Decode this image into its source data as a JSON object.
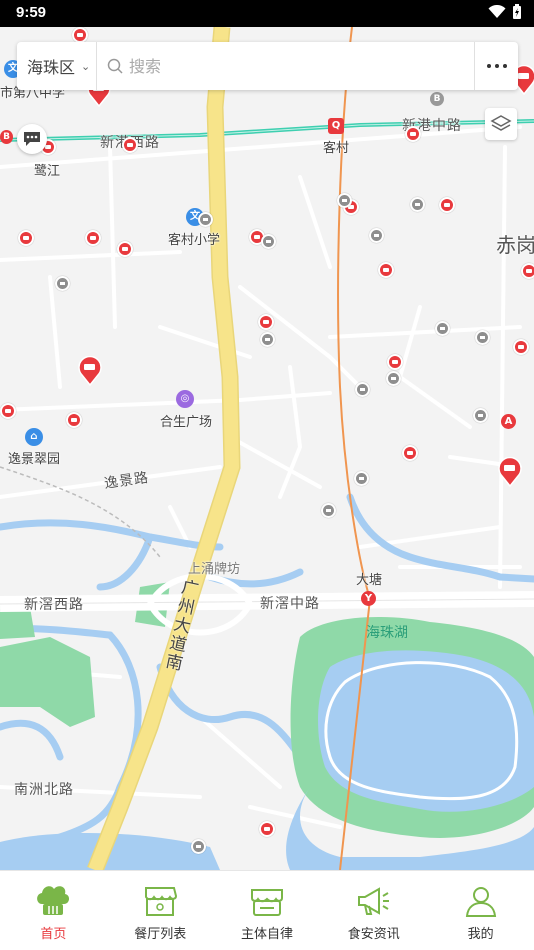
{
  "status_bar": {
    "time": "9:59"
  },
  "search": {
    "district": "海珠区",
    "placeholder": "搜索"
  },
  "map": {
    "labels": {
      "xinjiang_west": "新滘西路",
      "xinjiang_middle": "新滘中路",
      "xingang_west": "新港西路",
      "xingang_middle": "新港中路",
      "yijing_road": "逸景路",
      "nanzhou_north": "南洲北路",
      "kecun": "客村",
      "kecun_school": "客村小学",
      "lujiang": "鹭江",
      "hesheng": "合生广场",
      "yijingcuiyuan": "逸景翠园",
      "chigang": "赤岗",
      "shangyong": "上涌牌坊",
      "datang": "大塘",
      "haizhu_lake": "海珠湖",
      "school_top": "市第八中学",
      "guangzhou_avenue": "广州大道南"
    }
  },
  "tabs": [
    {
      "label": "首页"
    },
    {
      "label": "餐厅列表"
    },
    {
      "label": "主体自律"
    },
    {
      "label": "食安资讯"
    },
    {
      "label": "我的"
    }
  ],
  "colors": {
    "accent": "#e8393d",
    "tab_icon": "#7ab648",
    "main_road": "#f7e48a",
    "metro_line": "#3ecfb0",
    "water": "#a6cdf2",
    "park": "#8fd9a8"
  }
}
